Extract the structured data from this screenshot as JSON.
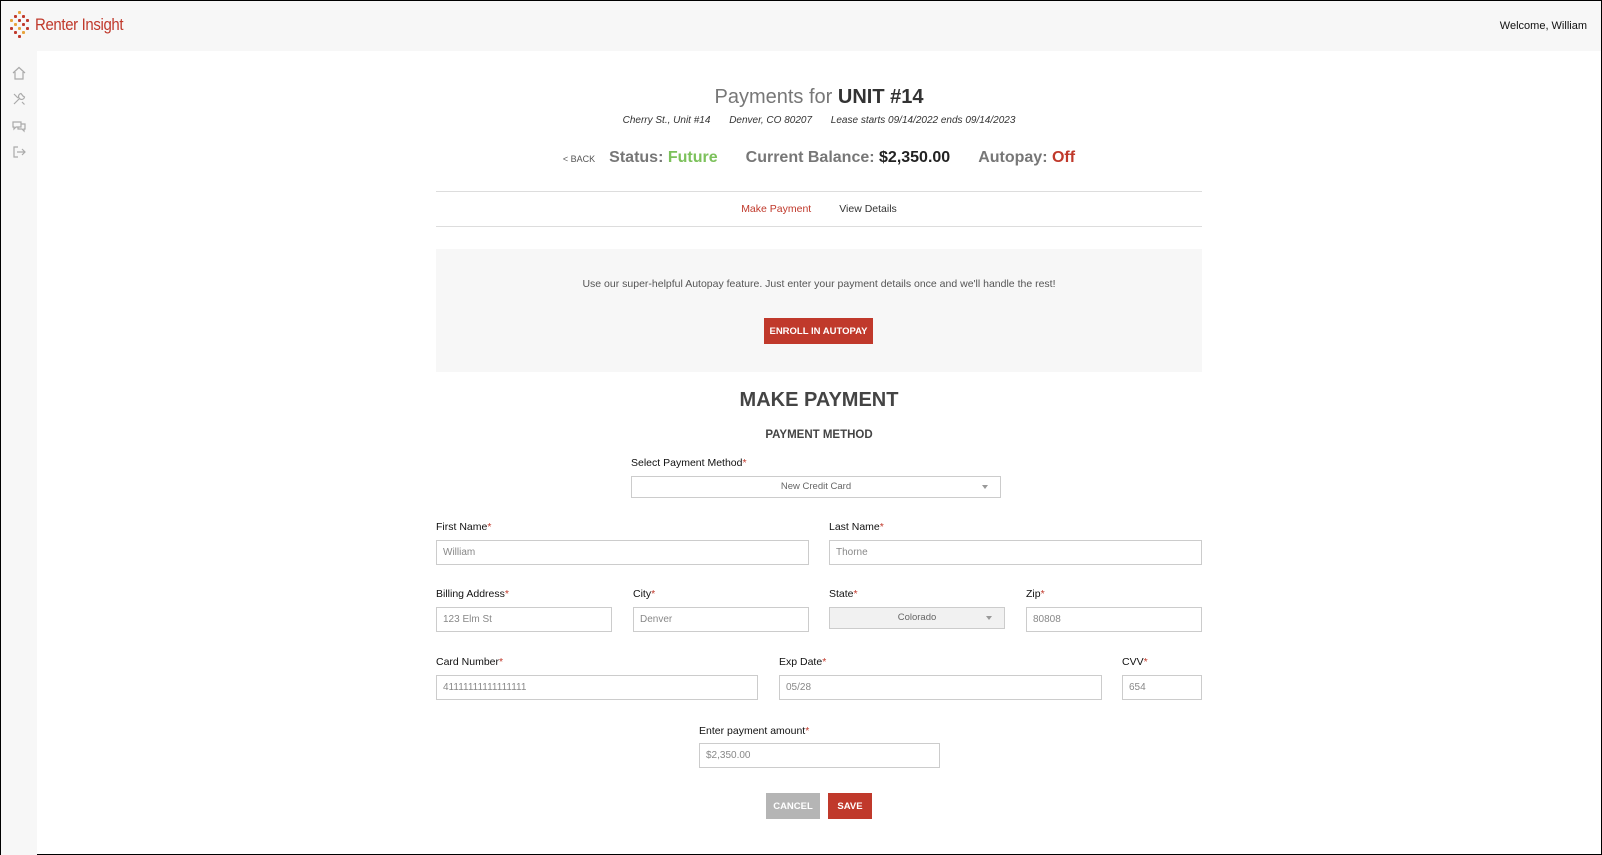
{
  "header": {
    "brand": "Renter Insight",
    "welcome": "Welcome, William",
    "brand_color": "#c0392b"
  },
  "sidebar": {
    "icons": [
      "home-icon",
      "tools-icon",
      "chat-icon",
      "logout-icon"
    ]
  },
  "page": {
    "title_prefix": "Payments for",
    "title_unit": "UNIT #14",
    "address": "Cherry St., Unit #14",
    "city": "Denver, CO 80207",
    "lease": "Lease starts 09/14/2022 ends 09/14/2023",
    "back": "< BACK",
    "status_label": "Status:",
    "status_value": "Future",
    "balance_label": "Current Balance:",
    "balance_value": "$2,350.00",
    "autopay_label": "Autopay:",
    "autopay_value": "Off"
  },
  "tabs": [
    {
      "label": "Make Payment",
      "active": true
    },
    {
      "label": "View Details",
      "active": false
    }
  ],
  "autopay_promo": {
    "text": "Use our super-helpful Autopay feature. Just enter your payment details once and we'll handle the rest!",
    "button": "ENROLL IN AUTOPAY"
  },
  "form": {
    "heading": "MAKE PAYMENT",
    "subheading": "PAYMENT METHOD",
    "payment_method": {
      "label": "Select Payment Method",
      "value": "New Credit Card"
    },
    "first_name": {
      "label": "First Name",
      "value": "William"
    },
    "last_name": {
      "label": "Last Name",
      "value": "Thorne"
    },
    "billing_address": {
      "label": "Billing Address",
      "value": "123 Elm St"
    },
    "city": {
      "label": "City",
      "value": "Denver"
    },
    "state": {
      "label": "State",
      "value": "Colorado"
    },
    "zip": {
      "label": "Zip",
      "value": "80808"
    },
    "card_number": {
      "label": "Card Number",
      "value": "41111111111111111"
    },
    "exp_date": {
      "label": "Exp Date",
      "value": "05/28"
    },
    "cvv": {
      "label": "CVV",
      "value": "654"
    },
    "amount": {
      "label": "Enter payment amount",
      "value": "$2,350.00"
    },
    "required_marker": "*",
    "cancel": "CANCEL",
    "save": "SAVE"
  }
}
